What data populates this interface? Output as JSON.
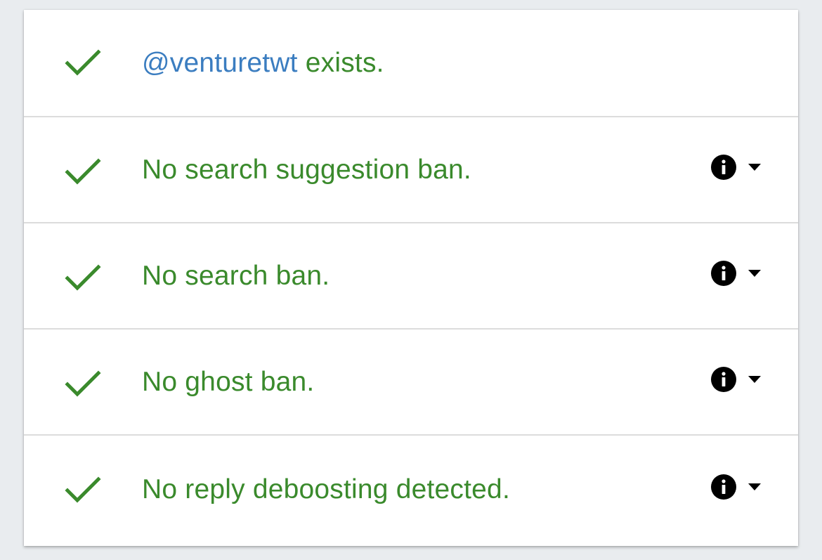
{
  "colors": {
    "success_green": "#3a8a2c",
    "handle_blue": "#3b7dc0",
    "icon_black": "#000000",
    "background": "#e9ecef"
  },
  "checks": [
    {
      "handle": "@venturetwt",
      "text": " exists.",
      "status_icon": "checkmark-icon",
      "has_actions": false
    },
    {
      "text": "No search suggestion ban.",
      "status_icon": "checkmark-icon",
      "has_actions": true,
      "action_icons": [
        "info-icon",
        "caret-down-icon"
      ]
    },
    {
      "text": "No search ban.",
      "status_icon": "checkmark-icon",
      "has_actions": true,
      "action_icons": [
        "info-icon",
        "caret-down-icon"
      ]
    },
    {
      "text": "No ghost ban.",
      "status_icon": "checkmark-icon",
      "has_actions": true,
      "action_icons": [
        "info-icon",
        "caret-down-icon"
      ]
    },
    {
      "text": "No reply deboosting detected.",
      "status_icon": "checkmark-icon",
      "has_actions": true,
      "action_icons": [
        "info-icon",
        "caret-down-icon"
      ]
    }
  ]
}
